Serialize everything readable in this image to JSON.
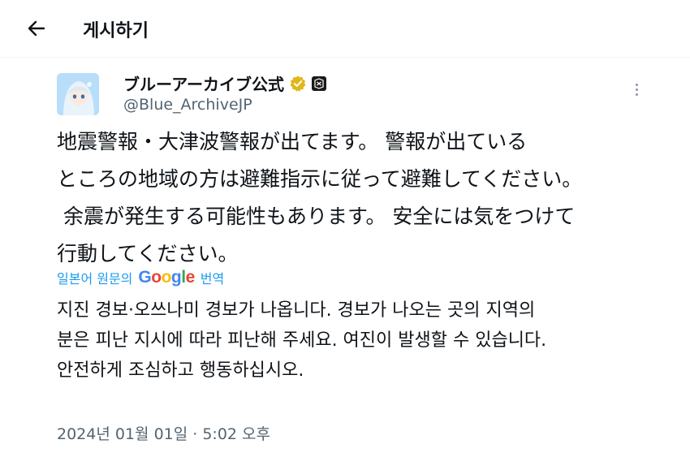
{
  "header": {
    "title": "게시하기",
    "back_icon": "arrow-left-icon"
  },
  "post": {
    "author": {
      "display_name": "ブルーアーカイブ公式",
      "handle": "@Blue_ArchiveJP",
      "verified_icon": "verified-badge-icon",
      "verified_color": "#e2b719",
      "affiliate_icon": "affiliate-badge-icon"
    },
    "menu_icon": "more-vertical-icon",
    "original_text": "地震警報・大津波警報が出てます。 警報が出ている\nところの地域の方は避難指示に従って避難してください。\n 余震が発生する可能性もあります。 安全には気をつけて\n行動してください。",
    "translation": {
      "prefix": "일본어 원문의",
      "provider": "Google",
      "suffix": "번역",
      "link_color": "#1d9bf0"
    },
    "translated_text": "지진 경보·오쓰나미 경보가 나옵니다. 경보가 나오는 곳의 지역의\n분은 피난 지시에 따라 피난해 주세요. 여진이 발생할 수 있습니다.\n안전하게 조심하고 행동하십시오.",
    "timestamp": "2024년 01월 01일 · 5:02 오후"
  }
}
